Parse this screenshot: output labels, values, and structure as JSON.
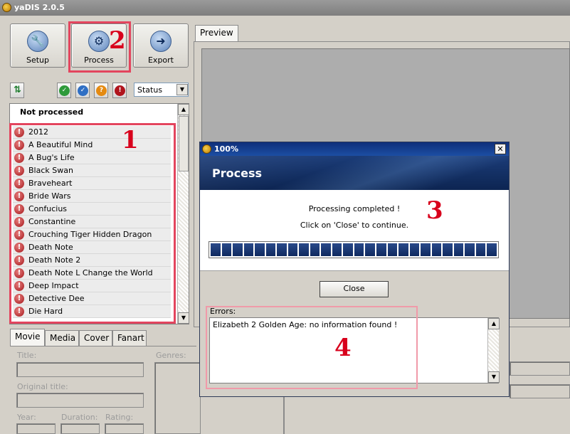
{
  "window": {
    "title": "yaDIS 2.0.5"
  },
  "toolbar": {
    "setup_label": "Setup",
    "process_label": "Process",
    "export_label": "Export"
  },
  "annotations": {
    "n1": "1",
    "n2": "2",
    "n3": "3",
    "n4": "4"
  },
  "filter": {
    "status_value": "Status"
  },
  "list": {
    "header": "Not processed",
    "items": [
      "2012",
      "A Beautiful Mind",
      "A Bug's Life",
      "Black Swan",
      "Braveheart",
      "Bride Wars",
      "Confucius",
      "Constantine",
      "Crouching Tiger Hidden Dragon",
      "Death Note",
      "Death Note 2",
      "Death Note L Change the World",
      "Deep Impact",
      "Detective Dee",
      "Die Hard"
    ]
  },
  "detail_tabs": [
    "Movie",
    "Media",
    "Cover",
    "Fanart"
  ],
  "movie_form": {
    "title_label": "Title:",
    "original_title_label": "Original title:",
    "year_label": "Year:",
    "duration_label": "Duration:",
    "rating_label": "Rating:",
    "genres_label": "Genres:"
  },
  "preview": {
    "tab_label": "Preview"
  },
  "dialog": {
    "title": "100%",
    "banner_title": "Process",
    "message_line1": "Processing completed !",
    "message_line2": "Click on 'Close' to continue.",
    "progress": 1.0,
    "close_label": "Close",
    "errors_label": "Errors:",
    "errors_text": "Elizabeth 2 Golden Age: no information found !"
  },
  "colors": {
    "annotation_red": "#d8001c",
    "banner_blue": "#1b3c78",
    "progress_blue": "#1f3e7c"
  },
  "icons": [
    "app-icon",
    "wrench-icon",
    "gear-icon",
    "arrow-right-icon",
    "refresh-icon",
    "check-green-icon",
    "check-blue-icon",
    "question-icon",
    "error-icon",
    "close-icon"
  ]
}
